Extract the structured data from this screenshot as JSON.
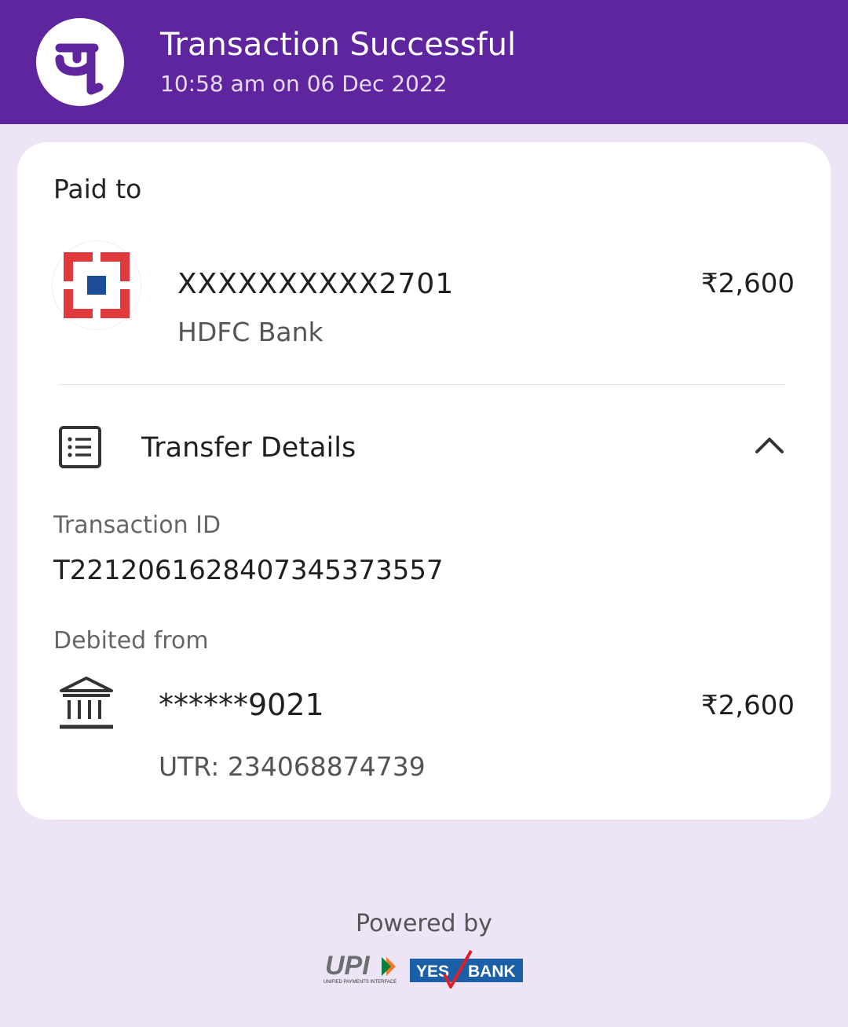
{
  "header": {
    "title": "Transaction Successful",
    "datetime": "10:58 am on 06 Dec 2022",
    "brand_icon": "phonepe-logo-icon"
  },
  "paid_to": {
    "label": "Paid to",
    "account": "XXXXXXXXXX2701",
    "bank": "HDFC Bank",
    "amount": "₹2,600",
    "bank_icon": "hdfc-bank-logo-icon"
  },
  "transfer_details": {
    "label": "Transfer Details",
    "icon": "list-icon",
    "toggle_icon": "chevron-up-icon",
    "transaction_id_label": "Transaction ID",
    "transaction_id": "T2212061628407345373557",
    "debited_from_label": "Debited from",
    "debited_account": "******9021",
    "debited_amount": "₹2,600",
    "utr": "UTR: 234068874739",
    "debit_icon": "bank-building-icon"
  },
  "footer": {
    "powered_by": "Powered by",
    "upi_text": "UPI",
    "upi_subtext": "UNIFIED PAYMENTS INTERFACE",
    "yes_text": "YES",
    "bank_text": "BANK"
  },
  "colors": {
    "brand_purple": "#5f259f",
    "background": "#ede4f6",
    "hdfc_red": "#e03a3e",
    "hdfc_blue": "#1c4c96",
    "yes_bank_blue": "#1b5fa8"
  }
}
